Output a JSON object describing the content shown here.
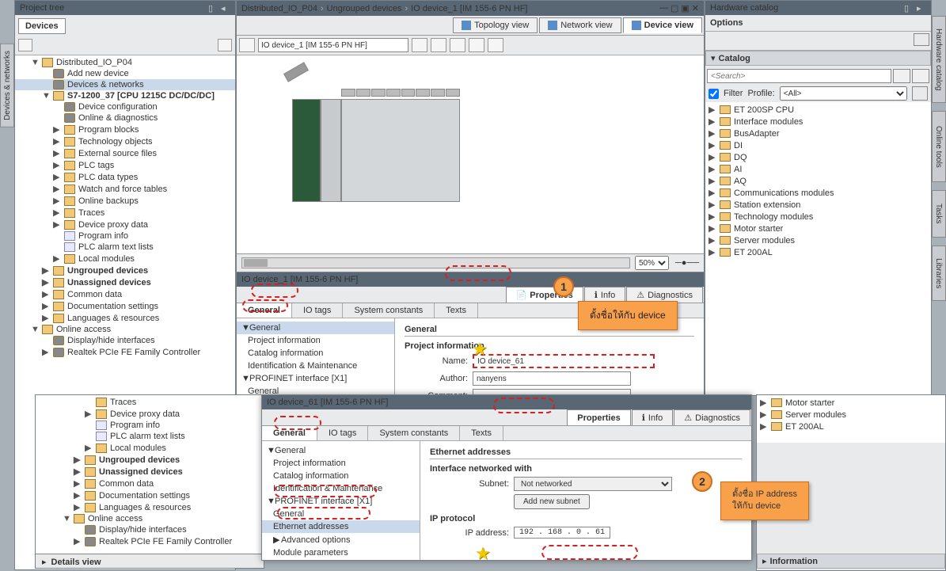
{
  "panels": {
    "project_tree_title": "Project tree",
    "hw_catalog_title": "Hardware catalog",
    "details_view": "Details view",
    "information": "Information"
  },
  "devices_tab": "Devices",
  "breadcrumb": {
    "p1": "Distributed_IO_P04",
    "p2": "Ungrouped devices",
    "p3": "IO device_1 [IM 155-6 PN HF]"
  },
  "view_tabs": {
    "topology": "Topology view",
    "network": "Network view",
    "device": "Device view"
  },
  "device_combo": "IO device_1 [IM 155-6 PN HF]",
  "zoom": "50%",
  "tree": [
    {
      "lvl": 1,
      "arrow": "▼",
      "t": "Distributed_IO_P04",
      "ico": "folder"
    },
    {
      "lvl": 2,
      "t": "Add new device",
      "ico": "gear"
    },
    {
      "lvl": 2,
      "t": "Devices & networks",
      "ico": "gear",
      "sel": true
    },
    {
      "lvl": 2,
      "arrow": "▼",
      "t": "S7-1200_37 [CPU 1215C DC/DC/DC]",
      "ico": "folder",
      "bold": true
    },
    {
      "lvl": 3,
      "t": "Device configuration",
      "ico": "gear"
    },
    {
      "lvl": 3,
      "t": "Online & diagnostics",
      "ico": "gear"
    },
    {
      "lvl": 3,
      "arrow": "▶",
      "t": "Program blocks",
      "ico": "folder"
    },
    {
      "lvl": 3,
      "arrow": "▶",
      "t": "Technology objects",
      "ico": "folder"
    },
    {
      "lvl": 3,
      "arrow": "▶",
      "t": "External source files",
      "ico": "folder"
    },
    {
      "lvl": 3,
      "arrow": "▶",
      "t": "PLC tags",
      "ico": "folder"
    },
    {
      "lvl": 3,
      "arrow": "▶",
      "t": "PLC data types",
      "ico": "folder"
    },
    {
      "lvl": 3,
      "arrow": "▶",
      "t": "Watch and force tables",
      "ico": "folder"
    },
    {
      "lvl": 3,
      "arrow": "▶",
      "t": "Online backups",
      "ico": "folder"
    },
    {
      "lvl": 3,
      "arrow": "▶",
      "t": "Traces",
      "ico": "folder"
    },
    {
      "lvl": 3,
      "arrow": "▶",
      "t": "Device proxy data",
      "ico": "folder"
    },
    {
      "lvl": 3,
      "t": "Program info",
      "ico": "doc"
    },
    {
      "lvl": 3,
      "t": "PLC alarm text lists",
      "ico": "doc"
    },
    {
      "lvl": 3,
      "arrow": "▶",
      "t": "Local modules",
      "ico": "folder"
    },
    {
      "lvl": 2,
      "arrow": "▶",
      "t": "Ungrouped devices",
      "ico": "folder",
      "bold": true
    },
    {
      "lvl": 2,
      "arrow": "▶",
      "t": "Unassigned devices",
      "ico": "folder",
      "bold": true
    },
    {
      "lvl": 2,
      "arrow": "▶",
      "t": "Common data",
      "ico": "folder"
    },
    {
      "lvl": 2,
      "arrow": "▶",
      "t": "Documentation settings",
      "ico": "folder"
    },
    {
      "lvl": 2,
      "arrow": "▶",
      "t": "Languages & resources",
      "ico": "folder"
    },
    {
      "lvl": 1,
      "arrow": "▼",
      "t": "Online access",
      "ico": "folder"
    },
    {
      "lvl": 2,
      "t": "Display/hide interfaces",
      "ico": "gear"
    },
    {
      "lvl": 2,
      "arrow": "▶",
      "t": "Realtek PCIe FE Family Controller",
      "ico": "gear"
    }
  ],
  "tree2": [
    {
      "lvl": 4,
      "t": "Traces",
      "ico": "folder"
    },
    {
      "lvl": 4,
      "arrow": "▶",
      "t": "Device proxy data",
      "ico": "folder"
    },
    {
      "lvl": 4,
      "t": "Program info",
      "ico": "doc"
    },
    {
      "lvl": 4,
      "t": "PLC alarm text lists",
      "ico": "doc"
    },
    {
      "lvl": 4,
      "arrow": "▶",
      "t": "Local modules",
      "ico": "folder"
    },
    {
      "lvl": 3,
      "arrow": "▶",
      "t": "Ungrouped devices",
      "ico": "folder",
      "bold": true
    },
    {
      "lvl": 3,
      "arrow": "▶",
      "t": "Unassigned devices",
      "ico": "folder",
      "bold": true
    },
    {
      "lvl": 3,
      "arrow": "▶",
      "t": "Common data",
      "ico": "folder"
    },
    {
      "lvl": 3,
      "arrow": "▶",
      "t": "Documentation settings",
      "ico": "folder"
    },
    {
      "lvl": 3,
      "arrow": "▶",
      "t": "Languages & resources",
      "ico": "folder"
    },
    {
      "lvl": 2,
      "arrow": "▼",
      "t": "Online access",
      "ico": "folder"
    },
    {
      "lvl": 3,
      "t": "Display/hide interfaces",
      "ico": "gear"
    },
    {
      "lvl": 3,
      "arrow": "▶",
      "t": "Realtek PCIe FE Family Controller",
      "ico": "gear"
    }
  ],
  "props": {
    "title1": "IO device_1 [IM 155-6 PN HF]",
    "title2": "IO device_61 [IM 155-6 PN HF]",
    "tab_props": "Properties",
    "tab_info": "Info",
    "tab_diag": "Diagnostics",
    "sub_general": "General",
    "sub_io": "IO tags",
    "sub_const": "System constants",
    "sub_texts": "Texts",
    "nav": [
      "General",
      "Project information",
      "Catalog information",
      "Identification & Maintenance",
      "PROFINET interface [X1]",
      "General",
      "Ethernet addresses",
      "Advanced options",
      "Module parameters"
    ],
    "section_general": "General",
    "section_projinfo": "Project information",
    "name_label": "Name:",
    "name_value": "IO device_61",
    "author_label": "Author:",
    "author_value": "nanyens",
    "comment_label": "Comment:",
    "section_eth": "Ethernet addresses",
    "section_iface": "Interface networked with",
    "subnet_label": "Subnet:",
    "subnet_value": "Not networked",
    "add_subnet": "Add new subnet",
    "section_ip": "IP protocol",
    "ip_label": "IP address:",
    "ip_value": "192 . 168 . 0   . 61"
  },
  "options_label": "Options",
  "catalog": {
    "header": "Catalog",
    "search_placeholder": "<Search>",
    "filter_label": "Filter",
    "profile_label": "Profile:",
    "profile_value": "<All>",
    "items": [
      "ET 200SP CPU",
      "Interface modules",
      "BusAdapter",
      "DI",
      "DQ",
      "AI",
      "AQ",
      "Communications modules",
      "Station extension",
      "Technology modules",
      "Motor starter",
      "Server modules",
      "ET 200AL"
    ],
    "items2": [
      "Motor starter",
      "Server modules",
      "ET 200AL"
    ]
  },
  "vtabs": {
    "left": "Devices & networks",
    "r1": "Hardware catalog",
    "r2": "Online tools",
    "r3": "Tasks",
    "r4": "Libraries"
  },
  "annotations": {
    "a1": "ตั้งชื่อให้กับ device",
    "a2_l1": "ตั้งชื่อ IP address",
    "a2_l2": "ให้กับ device",
    "n1": "1",
    "n2": "2"
  }
}
